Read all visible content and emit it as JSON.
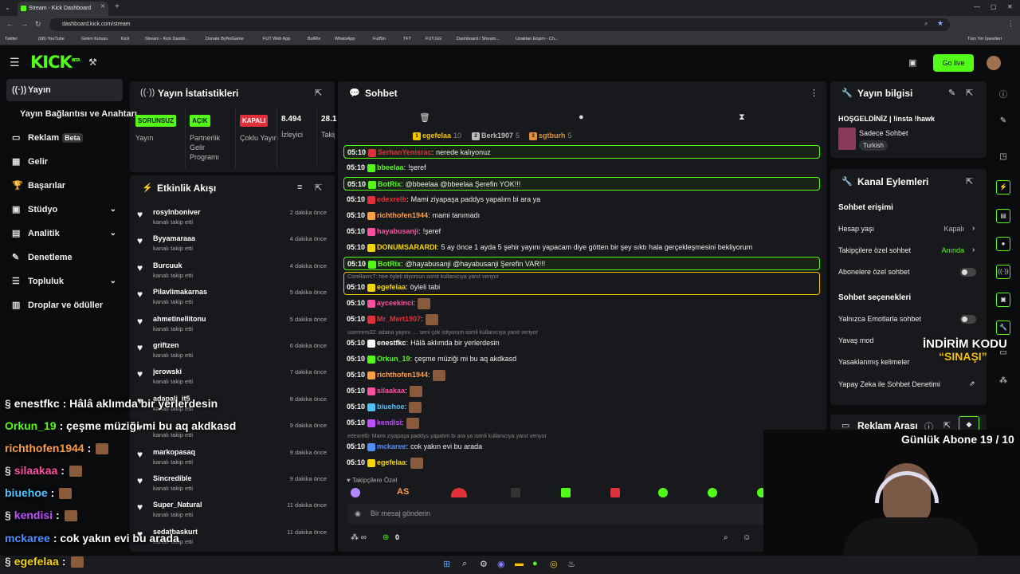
{
  "browser": {
    "tab_title": "Stream - Kick Dashboard",
    "url": "dashboard.kick.com/stream",
    "bookmarks": [
      "Twitter",
      "(68) YouTube",
      "Gelen Kutusu",
      "Kick",
      "Stream - Kick Dashb...",
      "Donate ByNoGame",
      "FUT Web App",
      "BotRix",
      "WhatsApp",
      "FutBin",
      "TFT",
      "FUT.GG",
      "Dashboard / Stream...",
      "Uzaktan Erişim - Ch..."
    ],
    "all_bookmarks": "Tüm Yer İşaretleri"
  },
  "header": {
    "logo": "KICK",
    "logo_sup": "BETA",
    "go_live": "Go live"
  },
  "sidebar": {
    "items": [
      {
        "label": "Yayın",
        "icon": "broadcast-icon"
      },
      {
        "label": "Yayın Bağlantısı ve Anahtarı",
        "icon": ""
      },
      {
        "label": "Reklam",
        "icon": "ad-icon",
        "badge": "Beta"
      },
      {
        "label": "Gelir",
        "icon": "chart-icon"
      },
      {
        "label": "Başarılar",
        "icon": "trophy-icon"
      },
      {
        "label": "Stüdyo",
        "icon": "studio-icon"
      },
      {
        "label": "Analitik",
        "icon": "analytics-icon"
      },
      {
        "label": "Denetleme",
        "icon": "mod-icon"
      },
      {
        "label": "Topluluk",
        "icon": "community-icon"
      },
      {
        "label": "Droplar ve ödüller",
        "icon": "gift-icon"
      }
    ]
  },
  "stats": {
    "title": "Yayın İstatistikleri",
    "items": [
      {
        "badge": "SORUNSUZ",
        "label": "Yayın",
        "color": "#53fc18"
      },
      {
        "badge": "AÇIK",
        "label": "Partnerlik Gelir Programı",
        "color": "#53fc18"
      },
      {
        "badge": "KAPALI",
        "label": "Çoklu Yayın",
        "color": "#e0313a"
      },
      {
        "num": "8.494",
        "label": "İzleyici"
      },
      {
        "num": "28.1",
        "label": "Takip"
      }
    ]
  },
  "activity": {
    "title": "Etkinlik Akışı",
    "sub": "kanalı takip etti",
    "items": [
      {
        "name": "rosylnboniver",
        "time": "2 dakika önce"
      },
      {
        "name": "Byyamaraaa",
        "time": "4 dakika önce"
      },
      {
        "name": "Burcuuk",
        "time": "4 dakika önce"
      },
      {
        "name": "Pilavlimakarnas",
        "time": "5 dakika önce"
      },
      {
        "name": "ahmetinellitonu",
        "time": "5 dakika önce"
      },
      {
        "name": "griftzen",
        "time": "6 dakika önce"
      },
      {
        "name": "jerowski",
        "time": "7 dakika önce"
      },
      {
        "name": "adapali_it5",
        "time": "8 dakika önce"
      },
      {
        "name": "",
        "time": "9 dakika önce"
      },
      {
        "name": "markopasaq",
        "time": "9 dakika önce"
      },
      {
        "name": "Sincredible",
        "time": "9 dakika önce"
      },
      {
        "name": "Super_Natural",
        "time": "11 dakika önce"
      },
      {
        "name": "sedatbaskurt",
        "time": "11 dakika önce"
      }
    ]
  },
  "chat": {
    "title": "Sohbet",
    "top": [
      {
        "rank": "1",
        "name": "egefelaa",
        "n": "10"
      },
      {
        "rank": "2",
        "name": "Berk1907",
        "n": "5"
      },
      {
        "rank": "3",
        "name": "sgtburh",
        "n": "5"
      }
    ],
    "lines": [
      {
        "t": "05:10",
        "u": "SerhanYenisrac",
        "c": "#e0313a",
        "m": "nerede kalıyonuz",
        "hl": true
      },
      {
        "t": "05:10",
        "u": "bbeelaa",
        "c": "#53fc18",
        "m": "!şeref"
      },
      {
        "t": "05:10",
        "u": "BotRix",
        "c": "#53fc18",
        "m": "@bbeelaa @bbeelaa Şerefin YOK!!!",
        "hl": true
      },
      {
        "t": "05:10",
        "u": "edexrelb",
        "c": "#e0313a",
        "m": "Mami ziyapaşa paddys yapalım bi ara ya"
      },
      {
        "t": "05:10",
        "u": "richthofen1944",
        "c": "#ff9f43",
        "m": "mami tanımadı"
      },
      {
        "t": "05:10",
        "u": "hayabusanji",
        "c": "#ff4fa3",
        "m": "!şeref"
      },
      {
        "t": "05:10",
        "u": "DONUMSARARDI",
        "c": "#f5d600",
        "m": "5 ay önce 1 ayda 5 şehir yayını yapacam diye götten bir şey sıktı hala gerçekleşmesini bekliyorum"
      },
      {
        "t": "05:10",
        "u": "BotRix",
        "c": "#53fc18",
        "m": "@hayabusanji @hayabusanji Şerefin VAR!!!",
        "hl": true
      },
      {
        "t": "05:10",
        "u": "egefelaa",
        "c": "#f5d600",
        "m": "öyleli tabi",
        "reply": "Corellaxrc7: hee öyleli diyorsun isimli kullanıcıya yanıt veriyor",
        "box": true
      },
      {
        "t": "05:10",
        "u": "ayceekinci",
        "c": "#ff4fa3",
        "m": ""
      },
      {
        "t": "05:10",
        "u": "Mr_Mert1907",
        "c": "#e0313a",
        "m": ""
      },
      {
        "t": "05:10",
        "u": "enestfkc",
        "c": "#fff",
        "m": "Hâlâ aklımda bir yerlerdesin",
        "reply": "userirem32: adana yayını .... seni çok istiyorum isimli kullanıcıya yanıt veriyor"
      },
      {
        "t": "05:10",
        "u": "Orkun_19",
        "c": "#53fc18",
        "m": "çeşme müziği mi bu aq akdkasd"
      },
      {
        "t": "05:10",
        "u": "richthofen1944",
        "c": "#ff9f43",
        "m": ""
      },
      {
        "t": "05:10",
        "u": "silaakaa",
        "c": "#ff4fa3",
        "m": ""
      },
      {
        "t": "05:10",
        "u": "biuehoe",
        "c": "#4fc3ff",
        "m": ""
      },
      {
        "t": "05:10",
        "u": "kendisi",
        "c": "#c04fff",
        "m": ""
      },
      {
        "t": "05:10",
        "u": "mckaree",
        "c": "#4f8fff",
        "m": "cok yakın evi bu arada",
        "reply": "edexrelb: Mami ziyapaşa paddys yapalım bi ara ya isimli kullanıcıya yanıt veriyor"
      },
      {
        "t": "05:10",
        "u": "egefelaa",
        "c": "#f5d600",
        "m": ""
      }
    ],
    "followers_only": "Takipçilere Özel",
    "input_placeholder": "Bir mesaj gönderin",
    "count": "0"
  },
  "info": {
    "title": "Yayın bilgisi",
    "stream_title": "HOŞGELDİNİZ | !insta !hawk",
    "category": "Sadece Sohbet",
    "tag": "Turkish"
  },
  "actions": {
    "title": "Kanal Eylemleri",
    "chat_access": "Sohbet erişimi",
    "rows1": [
      {
        "label": "Hesap yaşı",
        "value": "Kapalı"
      },
      {
        "label": "Takipçilere özel sohbet",
        "value": "Anında"
      },
      {
        "label": "Abonelere özel sohbet",
        "value": ""
      }
    ],
    "chat_options": "Sohbet seçenekleri",
    "rows2": [
      {
        "label": "Yalnızca Emotlarla sohbet"
      },
      {
        "label": "Yavaş mod"
      },
      {
        "label": "Yasaklanmış kelimeler"
      },
      {
        "label": "Yapay Zeka ile Sohbet Denetimi"
      }
    ]
  },
  "ad": {
    "title": "Reklam Arası"
  },
  "overlay": {
    "promo1": "İNDİRİM KODU",
    "promo2": "“SINAŞI”",
    "subs": "Günlük Abone 19 / 10",
    "chat": [
      {
        "u": "enestfkc",
        "c": "#fff",
        "m": ": Hâlâ aklımda bir yerlerdesin"
      },
      {
        "u": "Orkun_19",
        "c": "#53fc18",
        "m": ": çeşme müziği mi bu aq akdkasd"
      },
      {
        "u": "richthofen1944",
        "c": "#ff9f43",
        "m": ":"
      },
      {
        "u": "silaakaa",
        "c": "#ff4fa3",
        "m": ":"
      },
      {
        "u": "biuehoe",
        "c": "#4fc3ff",
        "m": ":"
      },
      {
        "u": "kendisi",
        "c": "#c04fff",
        "m": ":"
      },
      {
        "u": "mckaree",
        "c": "#4f8fff",
        "m": ": cok yakın evi bu arada"
      },
      {
        "u": "egefelaa",
        "c": "#f5d600",
        "m": ":"
      }
    ]
  }
}
